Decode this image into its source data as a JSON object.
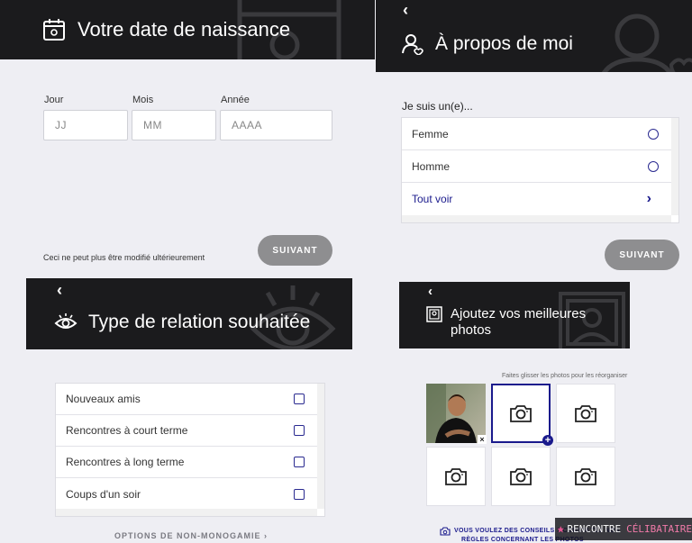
{
  "birthdate": {
    "title": "Votre date de naissance",
    "labels": {
      "day": "Jour",
      "month": "Mois",
      "year": "Année"
    },
    "placeholders": {
      "day": "JJ",
      "month": "MM",
      "year": "AAAA"
    },
    "note": "Ceci ne peut plus être modifié ultérieurement",
    "next_label": "SUIVANT"
  },
  "about": {
    "back": "‹",
    "title": "À propos de moi",
    "question": "Je suis un(e)...",
    "options": [
      "Femme",
      "Homme"
    ],
    "see_all": "Tout voir",
    "see_all_chevron": "›",
    "next_label": "SUIVANT"
  },
  "relation": {
    "back": "‹",
    "title": "Type de relation souhaitée",
    "options": [
      "Nouveaux amis",
      "Rencontres à court terme",
      "Rencontres à long terme",
      "Coups d'un soir"
    ],
    "non_mono_label": "OPTIONS DE NON-MONOGAMIE ›"
  },
  "photos": {
    "back": "‹",
    "title_line1": "Ajoutez vos meilleures",
    "title_line2": "photos",
    "hint": "Faites glisser les photos pour les réorganiser",
    "remove_icon": "×",
    "add_icon": "+",
    "advice": "VOUS VOULEZ DES CONSEILS ? CONSULTEZ NOS",
    "advice_line2": "RÈGLES CONCERNANT LES PHOTOS"
  },
  "watermark": {
    "text_a": "RENCONTRE",
    "text_b": "CÉLIBATAIRE"
  },
  "colors": {
    "banner": "#1b1b1d",
    "accent": "#1a1a8c",
    "button": "#8e8e90"
  }
}
